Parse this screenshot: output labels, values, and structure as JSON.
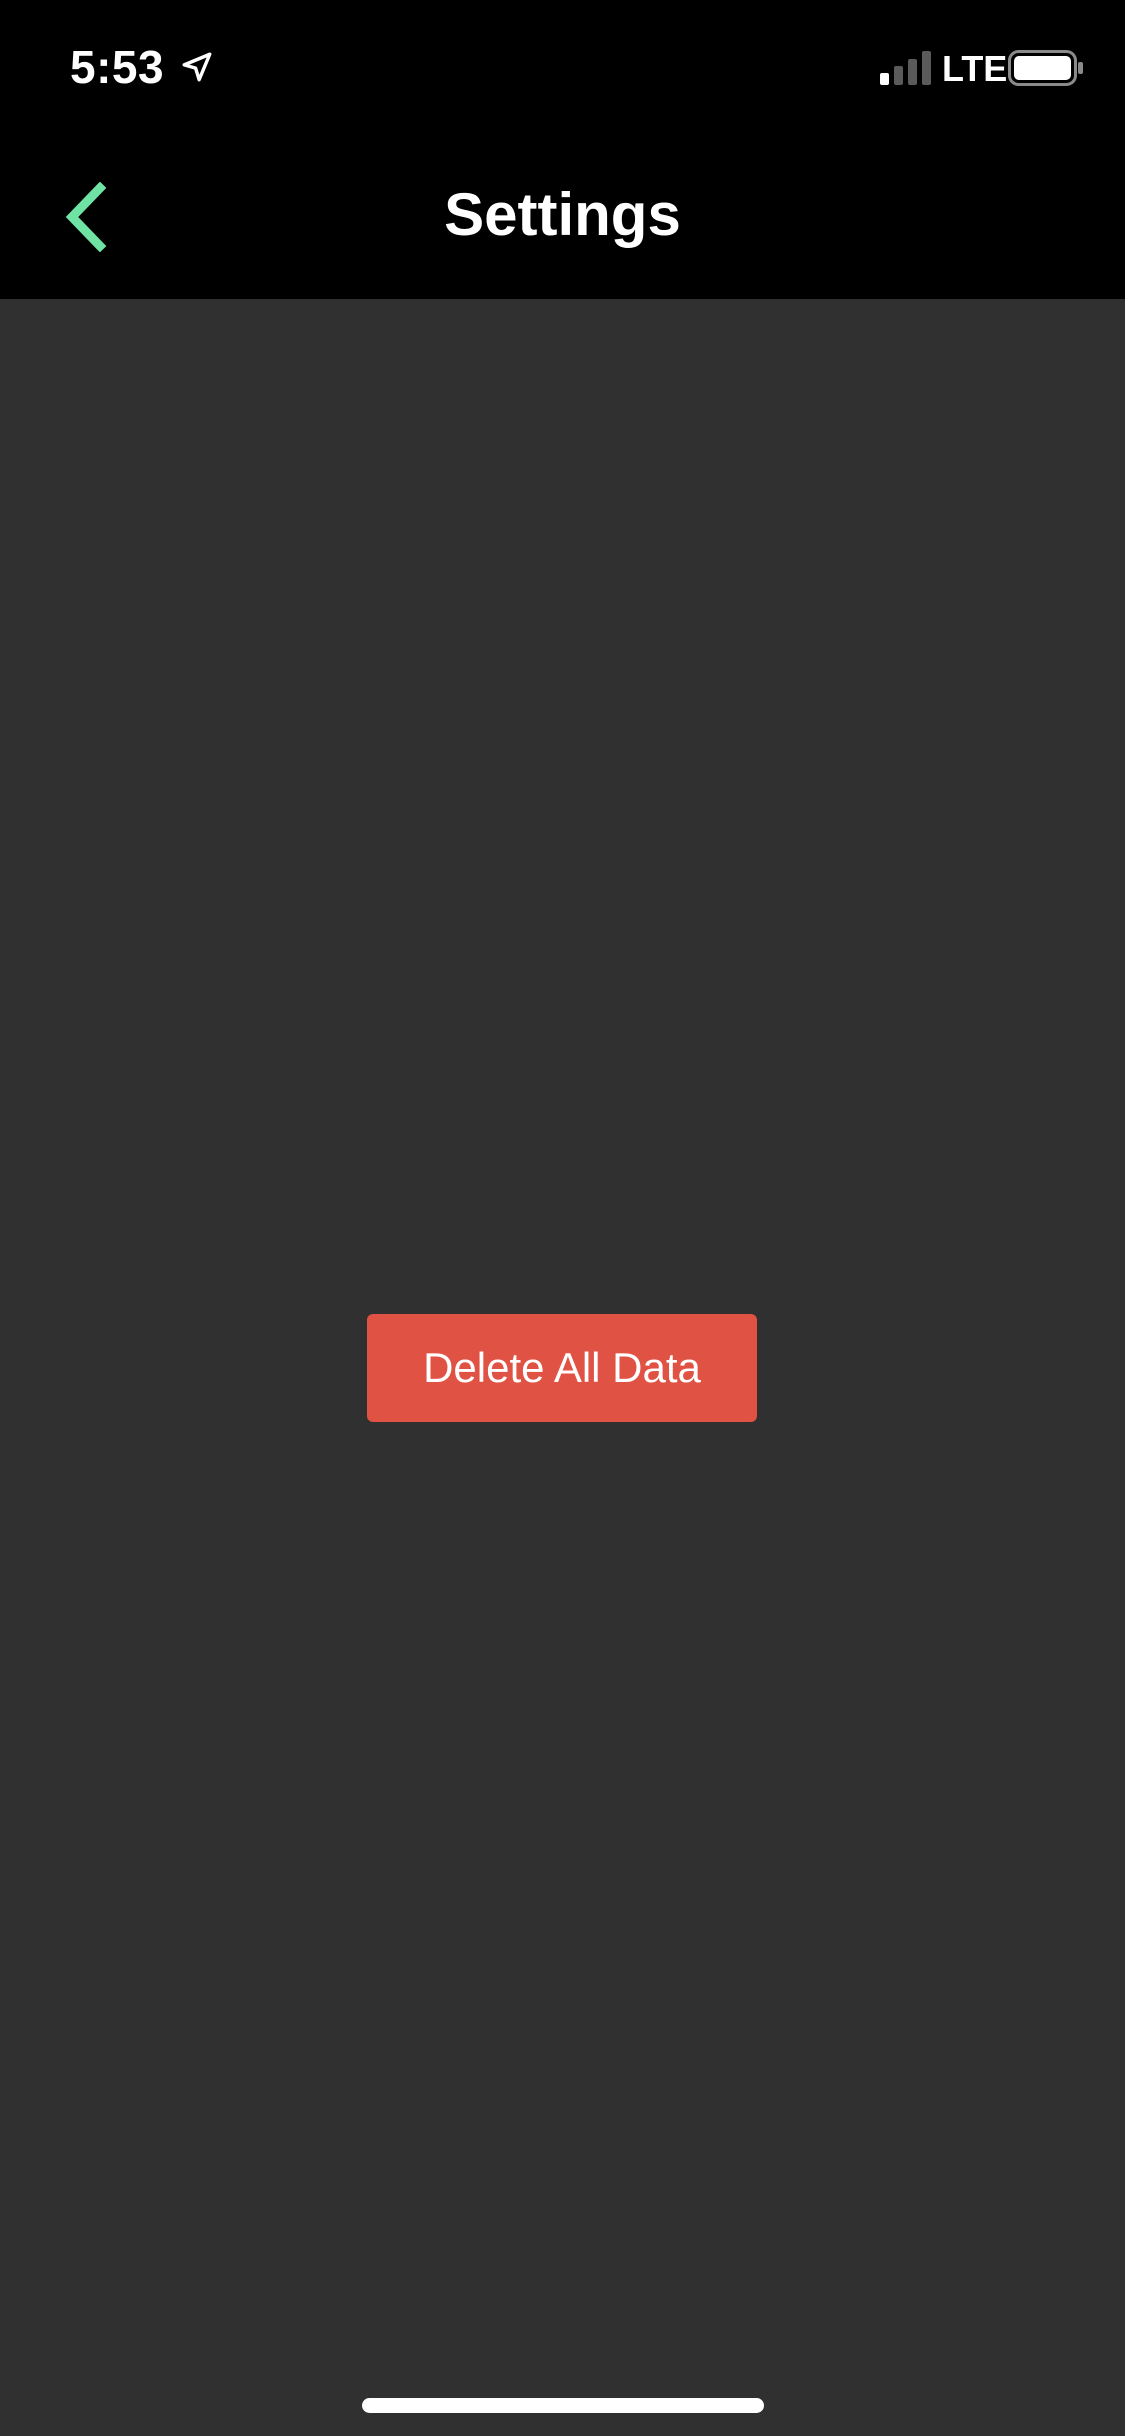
{
  "status_bar": {
    "time": "5:53",
    "network": "LTE",
    "icons": {
      "location": "location-arrow-icon",
      "signal": "cellular-signal-icon",
      "battery": "battery-icon"
    }
  },
  "nav": {
    "title": "Settings",
    "back_icon": "chevron-left-icon",
    "accent_color": "#6fe3a3"
  },
  "main": {
    "delete_button_label": "Delete All Data",
    "delete_button_color": "#e05243",
    "background_color": "#303030"
  }
}
